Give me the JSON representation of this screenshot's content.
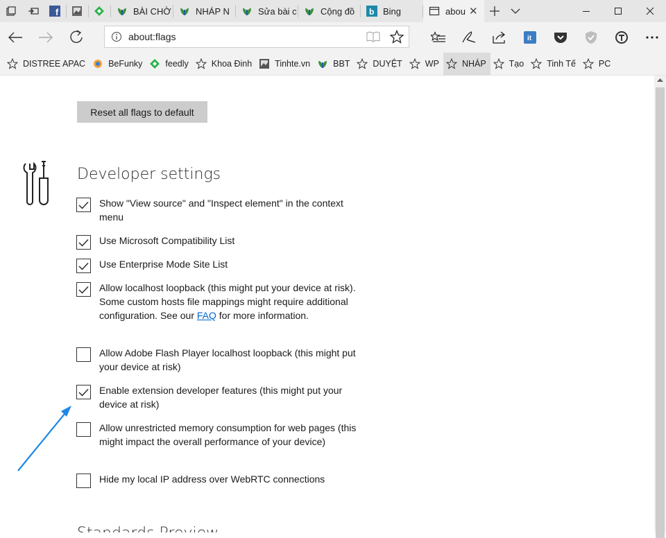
{
  "tabs": [
    {
      "label": "",
      "icon": "facebook-icon"
    },
    {
      "label": "",
      "icon": "image-icon"
    },
    {
      "label": "",
      "icon": "feedly-icon"
    },
    {
      "label": "BÀI CHỜ",
      "icon": "leaf-icon"
    },
    {
      "label": "NHÁP N",
      "icon": "leaf-icon"
    },
    {
      "label": "Sửa bài c",
      "icon": "leaf-icon"
    },
    {
      "label": "Cộng đồ",
      "icon": "leaf-icon"
    },
    {
      "label": "Bing",
      "icon": "bing-icon"
    },
    {
      "label": "abou",
      "icon": "page-icon",
      "active": true
    }
  ],
  "address": {
    "url": "about:flags"
  },
  "favorites": [
    {
      "label": "DISTREE APAC",
      "icon": "star-icon"
    },
    {
      "label": "BeFunky",
      "icon": "befunky-icon"
    },
    {
      "label": "feedly",
      "icon": "feedly-icon"
    },
    {
      "label": "Khoa Đinh",
      "icon": "star-icon"
    },
    {
      "label": "Tinhte.vn",
      "icon": "image-icon"
    },
    {
      "label": "BBT",
      "icon": "leaf-icon"
    },
    {
      "label": "DUYỆT",
      "icon": "star-icon"
    },
    {
      "label": "WP",
      "icon": "star-icon"
    },
    {
      "label": "NHÁP",
      "icon": "star-icon"
    },
    {
      "label": "Tạo",
      "icon": "star-icon"
    },
    {
      "label": "Tinh Tế",
      "icon": "star-icon"
    },
    {
      "label": "PC",
      "icon": "star-icon"
    }
  ],
  "page": {
    "reset_label": "Reset all flags to default",
    "section_title": "Developer settings",
    "section2_title": "Standards Preview",
    "options": [
      {
        "label": "Show \"View source\" and \"Inspect element\" in the context menu",
        "checked": true
      },
      {
        "label": "Use Microsoft Compatibility List",
        "checked": true
      },
      {
        "label": "Use Enterprise Mode Site List",
        "checked": true
      },
      {
        "label_before": "Allow localhost loopback (this might put your device at risk). Some custom hosts file mappings might require additional configuration. See our ",
        "link": "FAQ",
        "label_after": " for more information.",
        "checked": true
      },
      {
        "label": "Allow Adobe Flash Player localhost loopback (this might put your device at risk)",
        "checked": false
      },
      {
        "label": "Enable extension developer features (this might put your device at risk)",
        "checked": true
      },
      {
        "label": "Allow unrestricted memory consumption for web pages (this might impact the overall performance of your device)",
        "checked": false
      },
      {
        "label": "Hide my local IP address over WebRTC connections",
        "checked": false
      }
    ]
  },
  "colors": {
    "accent": "#0078d7",
    "arrow": "#1e88e5",
    "link": "#0066cc"
  }
}
